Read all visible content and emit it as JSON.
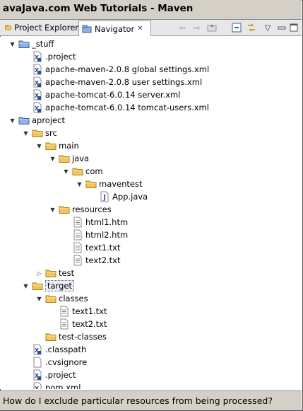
{
  "window": {
    "title": "avaJava.com Web Tutorials - Maven"
  },
  "tabs": {
    "project_explorer": "Project Explorer",
    "navigator": "Navigator"
  },
  "toolbar": {
    "back_icon": "back-arrow-icon",
    "forward_icon": "forward-arrow-icon",
    "up_icon": "up-folder-icon",
    "collapse_icon": "collapse-all-icon",
    "link_icon": "link-with-editor-icon",
    "menu_icon": "view-menu-icon",
    "minimize_icon": "minimize-icon",
    "maximize_icon": "maximize-icon"
  },
  "tree": [
    {
      "name": "folder-stuff",
      "label": "_stuff",
      "type": "project-folder",
      "depth": 0,
      "twisty": "open"
    },
    {
      "name": "file-project-stuff",
      "label": ".project",
      "type": "xml",
      "depth": 1,
      "twisty": ""
    },
    {
      "name": "file-maven-global-settings",
      "label": "apache-maven-2.0.8 global settings.xml",
      "type": "xml",
      "depth": 1,
      "twisty": ""
    },
    {
      "name": "file-maven-user-settings",
      "label": "apache-maven-2.0.8 user settings.xml",
      "type": "xml",
      "depth": 1,
      "twisty": ""
    },
    {
      "name": "file-tomcat-server",
      "label": "apache-tomcat-6.0.14 server.xml",
      "type": "xml",
      "depth": 1,
      "twisty": ""
    },
    {
      "name": "file-tomcat-users",
      "label": "apache-tomcat-6.0.14 tomcat-users.xml",
      "type": "xml",
      "depth": 1,
      "twisty": ""
    },
    {
      "name": "folder-aproject",
      "label": "aproject",
      "type": "project-folder",
      "depth": 0,
      "twisty": "open"
    },
    {
      "name": "folder-src",
      "label": "src",
      "type": "folder",
      "depth": 1,
      "twisty": "open"
    },
    {
      "name": "folder-main",
      "label": "main",
      "type": "folder",
      "depth": 2,
      "twisty": "open"
    },
    {
      "name": "folder-java",
      "label": "java",
      "type": "folder",
      "depth": 3,
      "twisty": "open"
    },
    {
      "name": "folder-com",
      "label": "com",
      "type": "folder",
      "depth": 4,
      "twisty": "open"
    },
    {
      "name": "folder-maventest",
      "label": "maventest",
      "type": "folder",
      "depth": 5,
      "twisty": "open"
    },
    {
      "name": "file-app-java",
      "label": "App.java",
      "type": "java",
      "depth": 6,
      "twisty": ""
    },
    {
      "name": "folder-resources",
      "label": "resources",
      "type": "folder",
      "depth": 3,
      "twisty": "open"
    },
    {
      "name": "file-html1",
      "label": "html1.htm",
      "type": "text",
      "depth": 4,
      "twisty": ""
    },
    {
      "name": "file-html2",
      "label": "html2.htm",
      "type": "text",
      "depth": 4,
      "twisty": ""
    },
    {
      "name": "file-text1-res",
      "label": "text1.txt",
      "type": "text",
      "depth": 4,
      "twisty": ""
    },
    {
      "name": "file-text2-res",
      "label": "text2.txt",
      "type": "text",
      "depth": 4,
      "twisty": ""
    },
    {
      "name": "folder-test",
      "label": "test",
      "type": "folder",
      "depth": 2,
      "twisty": "closed"
    },
    {
      "name": "folder-target",
      "label": "target",
      "type": "folder",
      "depth": 1,
      "twisty": "open",
      "selected": true
    },
    {
      "name": "folder-classes",
      "label": "classes",
      "type": "folder",
      "depth": 2,
      "twisty": "open"
    },
    {
      "name": "file-text1-classes",
      "label": "text1.txt",
      "type": "text",
      "depth": 3,
      "twisty": ""
    },
    {
      "name": "file-text2-classes",
      "label": "text2.txt",
      "type": "text",
      "depth": 3,
      "twisty": ""
    },
    {
      "name": "folder-test-classes",
      "label": "test-classes",
      "type": "folder",
      "depth": 2,
      "twisty": ""
    },
    {
      "name": "file-classpath",
      "label": ".classpath",
      "type": "xml",
      "depth": 1,
      "twisty": ""
    },
    {
      "name": "file-cvsignore",
      "label": ".cvsignore",
      "type": "blank",
      "depth": 1,
      "twisty": ""
    },
    {
      "name": "file-project-aproject",
      "label": ".project",
      "type": "xml",
      "depth": 1,
      "twisty": ""
    },
    {
      "name": "file-pom",
      "label": "pom.xml",
      "type": "xml",
      "depth": 1,
      "twisty": ""
    }
  ],
  "status": {
    "caption": "How do I exclude particular resources from being processed?"
  },
  "colors": {
    "title_bg": "#d4d0c8",
    "folder": "#f3c55b",
    "project_folder": "#8fb0e0",
    "selection": "#e9eef9"
  }
}
